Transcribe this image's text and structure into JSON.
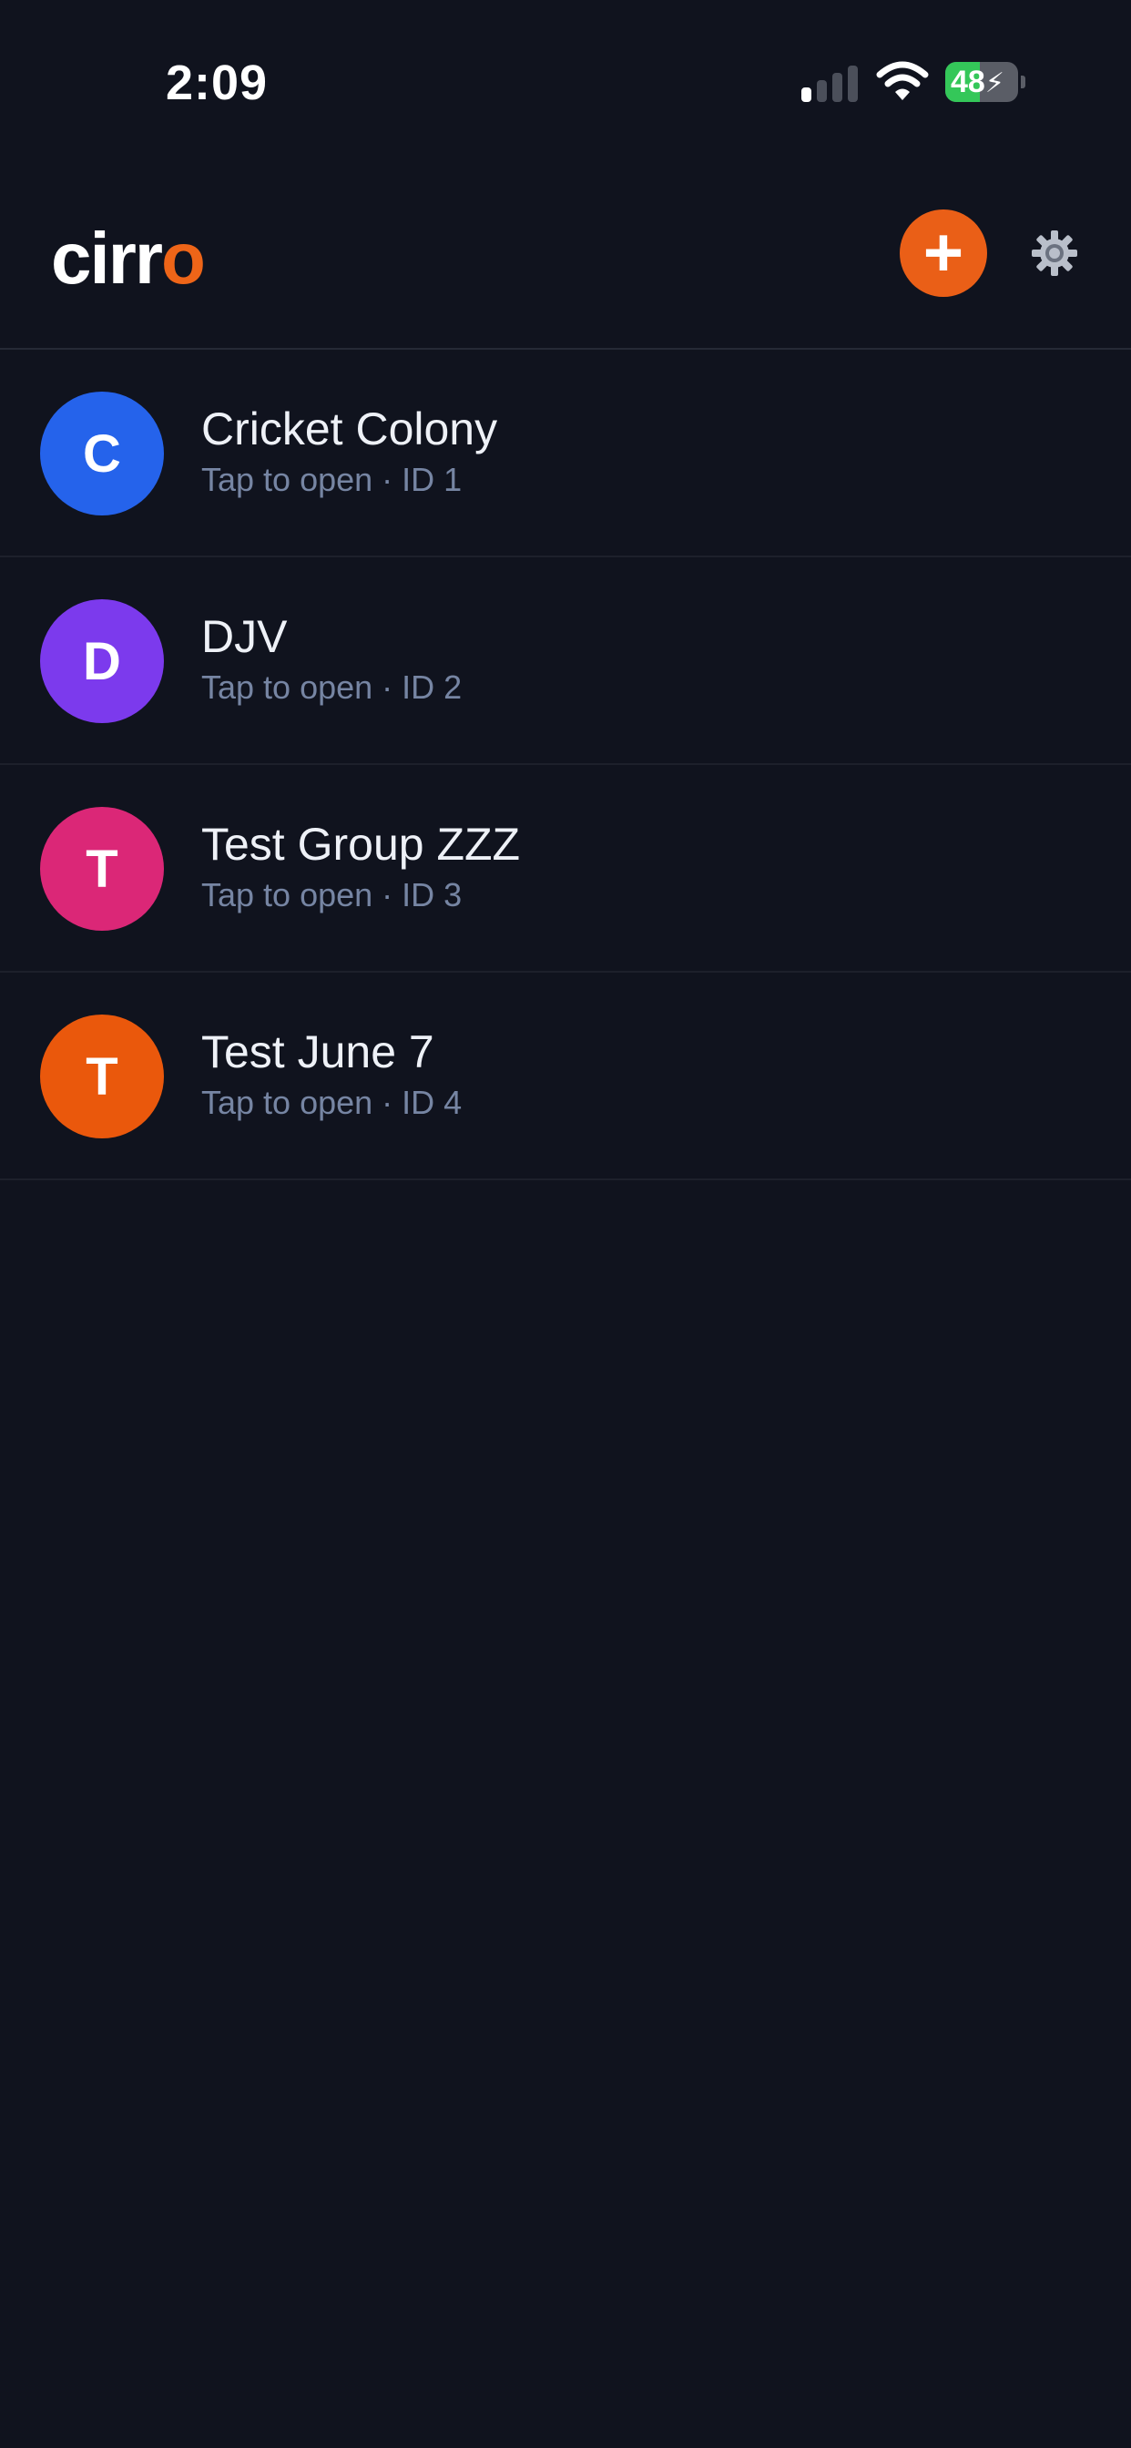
{
  "status_bar": {
    "time": "2:09",
    "battery_percent": "48",
    "battery_level": 0.48,
    "battery_charging": true,
    "signal_bars_active": 1,
    "signal_bars_total": 4
  },
  "header": {
    "logo_main": "cirr",
    "logo_accent": "o",
    "add_icon": "plus-icon",
    "add_glyph": "+",
    "settings_icon": "gear-icon"
  },
  "colors": {
    "background": "#10131e",
    "accent": "#ea5f17"
  },
  "groups": [
    {
      "initial": "C",
      "name": "Cricket Colony",
      "subtitle": "Tap to open · ID 1",
      "color": "#2563eb"
    },
    {
      "initial": "D",
      "name": "DJV",
      "subtitle": "Tap to open · ID 2",
      "color": "#7c3aed"
    },
    {
      "initial": "T",
      "name": "Test Group ZZZ",
      "subtitle": "Tap to open · ID 3",
      "color": "#db2777"
    },
    {
      "initial": "T",
      "name": "Test June 7",
      "subtitle": "Tap to open · ID 4",
      "color": "#ea580c"
    }
  ]
}
